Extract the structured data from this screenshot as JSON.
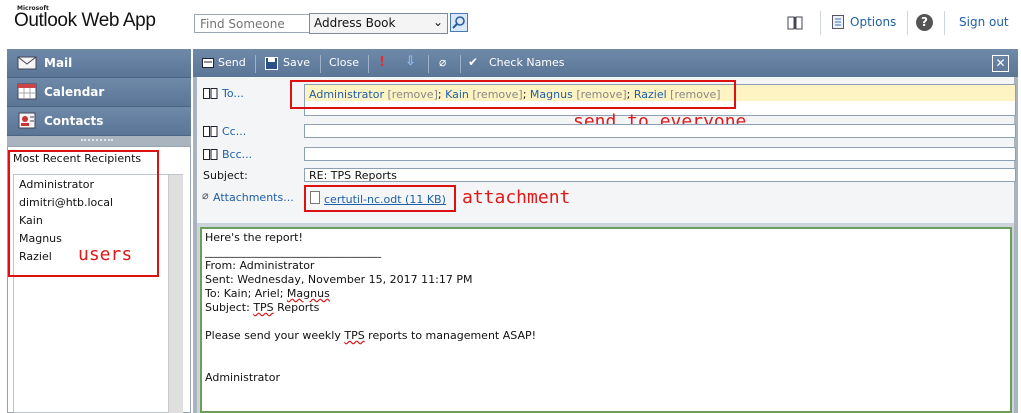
{
  "header": {
    "brand_small": "Microsoft",
    "brand": "Outlook Web App",
    "find_placeholder": "Find Someone",
    "address_book_select": "Address Book",
    "options_label": "Options",
    "help_label": "?",
    "signout_label": "Sign out"
  },
  "nav": {
    "items": [
      {
        "label": "Mail",
        "icon": "mail-icon"
      },
      {
        "label": "Calendar",
        "icon": "calendar-icon"
      },
      {
        "label": "Contacts",
        "icon": "contacts-icon"
      }
    ],
    "recent_title": "Most Recent Recipients",
    "recent": [
      "Administrator",
      "dimitri@htb.local",
      "Kain",
      "Magnus",
      "Raziel"
    ]
  },
  "toolbar": {
    "send": "Send",
    "save": "Save",
    "close": "Close",
    "check_names": "Check Names"
  },
  "compose": {
    "to_label": "To...",
    "cc_label": "Cc...",
    "bcc_label": "Bcc...",
    "subject_label": "Subject:",
    "attachments_label": "Attachments...",
    "remove_label": "[remove]",
    "recipients": [
      "Administrator",
      "Kain",
      "Magnus",
      "Raziel"
    ],
    "subject": "RE: TPS Reports",
    "attachment": "certutil-nc.odt (11 KB)",
    "body": {
      "line1": "Here's the report!",
      "separator": "________________________________",
      "from": "From: Administrator",
      "sent": "Sent: Wednesday, November 15, 2017 11:17 PM",
      "to_pre": "To: Kain; Ariel; ",
      "to_magnus": "Magnus",
      "subject_pre": "Subject: ",
      "subject_tps": "TPS",
      "subject_post": " Reports",
      "msg_pre": "Please send your weekly ",
      "msg_tps": "TPS",
      "msg_post": " reports to management ASAP!",
      "signature": "Administrator"
    }
  },
  "annotations": {
    "to": "send to everyone",
    "attachment": "attachment",
    "users": "users",
    "color": "#dd1111"
  }
}
